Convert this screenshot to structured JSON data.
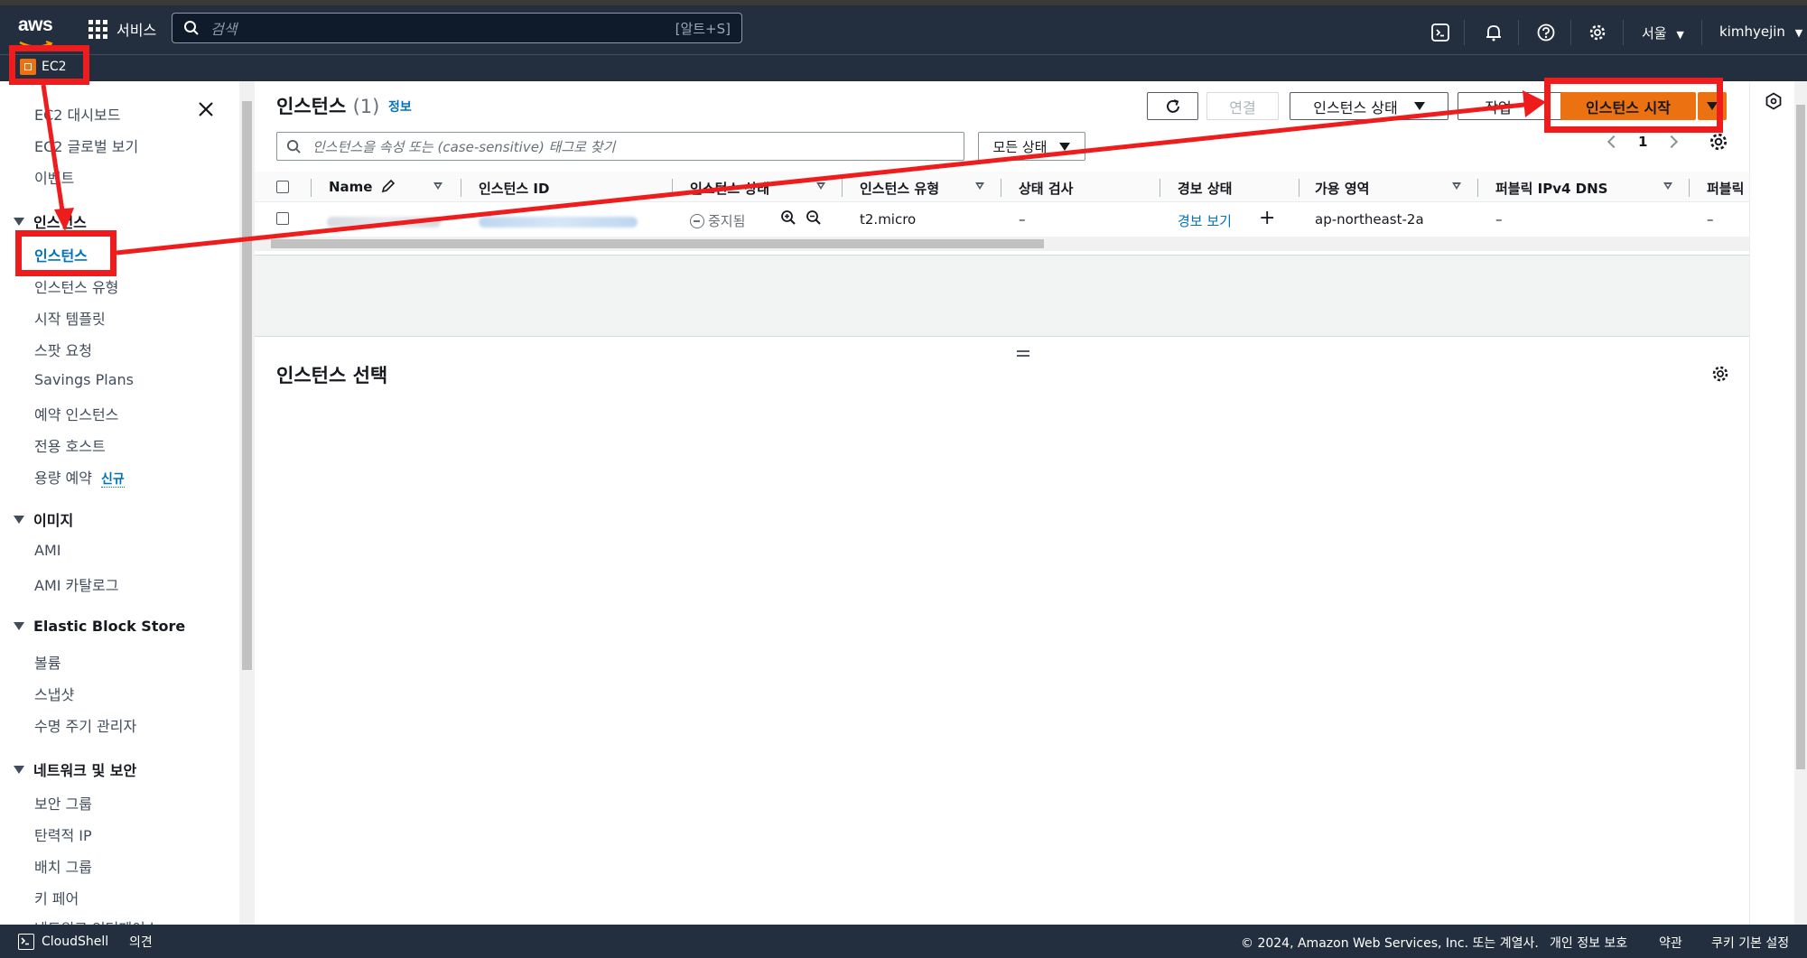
{
  "topnav": {
    "logo": "aws",
    "services_label": "서비스",
    "search_placeholder": "검색",
    "search_shortcut": "[알트+S]",
    "region": "서울",
    "user": "kimhyejin"
  },
  "subnav": {
    "service": "EC2"
  },
  "sidebar": {
    "top_links": [
      "EC2 대시보드",
      "EC2 글로벌 보기",
      "이벤트"
    ],
    "groups": [
      {
        "title": "인스턴스",
        "items": [
          "인스턴스",
          "인스턴스 유형",
          "시작 템플릿",
          "스팟 요청",
          "Savings Plans",
          "예약 인스턴스",
          "전용 호스트",
          "용량 예약"
        ]
      },
      {
        "title": "이미지",
        "items": [
          "AMI",
          "AMI 카탈로그"
        ]
      },
      {
        "title": "Elastic Block Store",
        "items": [
          "볼륨",
          "스냅샷",
          "수명 주기 관리자"
        ]
      },
      {
        "title": "네트워크 및 보안",
        "items": [
          "보안 그룹",
          "탄력적 IP",
          "배치 그룹",
          "키 페어",
          "네트워크 인터페이스"
        ]
      }
    ],
    "new_badge": "신규",
    "active_item": "인스턴스"
  },
  "instances": {
    "title": "인스턴스",
    "count": "(1)",
    "info": "정보",
    "connect": "연결",
    "state_menu": "인스턴스 상태",
    "actions": "작업",
    "launch": "인스턴스 시작",
    "filter_placeholder": "인스턴스을 속성 또는 (case-sensitive) 태그로 찾기",
    "all_states": "모든 상태",
    "page": "1",
    "columns": [
      "Name",
      "인스턴스 ID",
      "인스턴스 상태",
      "인스턴스 유형",
      "상태 검사",
      "경보 상태",
      "가용 영역",
      "퍼블릭 IPv4 DNS",
      "퍼블릭"
    ],
    "row": {
      "name": "████████████",
      "id": "i-0████████████████",
      "state": "중지됨",
      "type": "t2.micro",
      "status_check": "–",
      "alarm": "경보 보기",
      "az": "ap-northeast-2a",
      "dns": "–",
      "public": "–"
    }
  },
  "detail": {
    "title": "인스턴스 선택"
  },
  "footer": {
    "cloudshell": "CloudShell",
    "feedback": "의견",
    "copyright": "© 2024, Amazon Web Services, Inc. 또는 계열사.",
    "privacy": "개인 정보 보호",
    "terms": "약관",
    "cookies": "쿠키 기본 설정"
  },
  "colors": {
    "nav": "#232f3e",
    "accent": "#ec7211",
    "link": "#0073bb",
    "annotation": "#ee1c1c"
  }
}
